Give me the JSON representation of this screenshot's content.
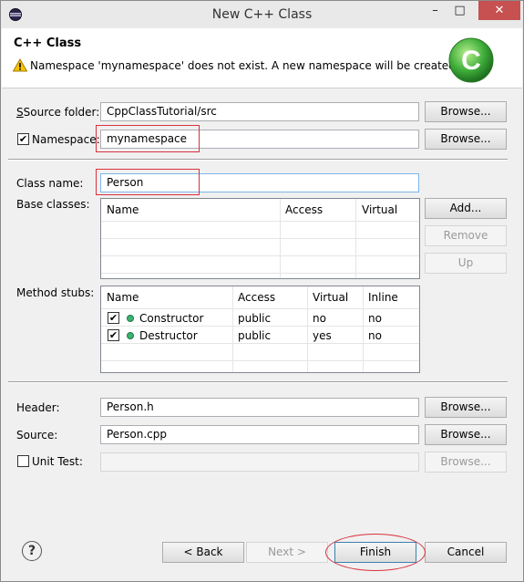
{
  "window": {
    "title": "New C++ Class",
    "minimize": "–",
    "maximize": "□",
    "close": "✕"
  },
  "header": {
    "title": "C++ Class",
    "message": "Namespace 'mynamespace' does not exist. A new namespace will be created.",
    "logo_letter": "C"
  },
  "form": {
    "source_folder_label": "Source folder:",
    "source_folder_value": "CppClassTutorial/src",
    "namespace_checked": true,
    "namespace_label": "Namespace:",
    "namespace_value": "mynamespace",
    "class_name_label": "Class name:",
    "class_name_value": "Person",
    "base_classes_label": "Base classes:",
    "method_stubs_label": "Method stubs:",
    "header_label": "Header:",
    "header_value": "Person.h",
    "source_label": "Source:",
    "source_value": "Person.cpp",
    "unit_test_checked": false,
    "unit_test_label": "Unit Test:"
  },
  "base_classes_table": {
    "columns": [
      "Name",
      "Access",
      "Virtual"
    ],
    "rows": []
  },
  "method_stubs_table": {
    "columns": [
      "Name",
      "Access",
      "Virtual",
      "Inline"
    ],
    "rows": [
      {
        "checked": true,
        "name": "Constructor",
        "access": "public",
        "virtual": "no",
        "inline": "no"
      },
      {
        "checked": true,
        "name": "Destructor",
        "access": "public",
        "virtual": "yes",
        "inline": "no"
      }
    ]
  },
  "buttons": {
    "browse": "Browse...",
    "add": "Add...",
    "remove": "Remove",
    "up": "Up",
    "help": "?",
    "back": "< Back",
    "next": "Next >",
    "finish": "Finish",
    "cancel": "Cancel"
  },
  "colors": {
    "accent_red": "#d8323c",
    "logo_green": "#3fae3a",
    "close_button": "#c75050"
  }
}
